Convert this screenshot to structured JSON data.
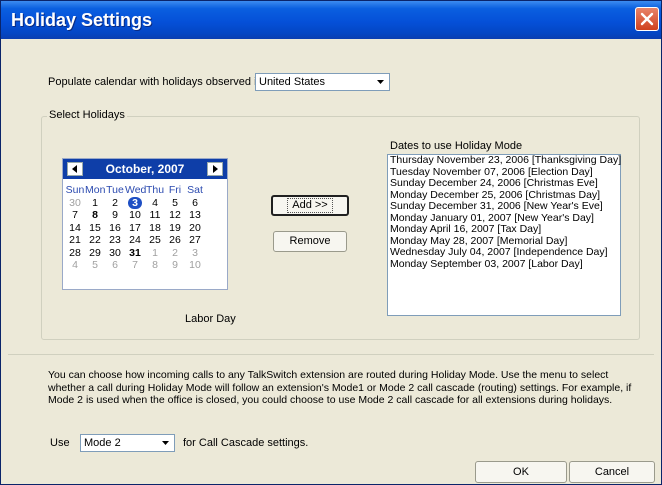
{
  "window": {
    "title": "Holiday Settings"
  },
  "populate": {
    "label": "Populate calendar with holidays observed in:",
    "country": "United States"
  },
  "select_holidays": {
    "legend": "Select Holidays"
  },
  "calendar": {
    "month_label": "October, 2007",
    "weekdays": [
      "Sun",
      "Mon",
      "Tue",
      "Wed",
      "Thu",
      "Fri",
      "Sat"
    ],
    "weeks": [
      [
        "30",
        "1",
        "2",
        "3",
        "4",
        "5",
        "6"
      ],
      [
        "7",
        "8",
        "9",
        "10",
        "11",
        "12",
        "13"
      ],
      [
        "14",
        "15",
        "16",
        "17",
        "18",
        "19",
        "20"
      ],
      [
        "21",
        "22",
        "23",
        "24",
        "25",
        "26",
        "27"
      ],
      [
        "28",
        "29",
        "30",
        "31",
        "1",
        "2",
        "3"
      ],
      [
        "4",
        "5",
        "6",
        "7",
        "8",
        "9",
        "10"
      ]
    ],
    "selected_holiday": "Labor Day"
  },
  "buttons": {
    "add": "Add >>",
    "remove": "Remove",
    "ok": "OK",
    "cancel": "Cancel"
  },
  "dates_list": {
    "title": "Dates to use Holiday Mode",
    "items": [
      "Thursday November 23, 2006  [Thanksgiving Day]",
      "Tuesday November 07, 2006  [Election Day]",
      "Sunday December 24, 2006  [Christmas Eve]",
      "Monday December 25, 2006  [Christmas Day]",
      "Sunday December 31, 2006  [New Year's Eve]",
      "Monday January 01, 2007  [New Year's Day]",
      "Monday April 16, 2007  [Tax Day]",
      "Monday May 28, 2007  [Memorial Day]",
      "Wednesday July 04, 2007  [Independence Day]",
      "Monday September 03, 2007  [Labor Day]"
    ]
  },
  "description": "You can choose how incoming calls to any TalkSwitch extension are routed during Holiday Mode. Use the menu to select whether a call during Holiday Mode will follow an extension's Mode1 or Mode 2 call cascade (routing) settings. For example, if Mode 2 is used when the office is closed, you could choose to use Mode 2 call cascade for all extensions during holidays.",
  "cascade": {
    "use_label": "Use",
    "mode_value": "Mode 2",
    "suffix": "for Call Cascade settings."
  }
}
